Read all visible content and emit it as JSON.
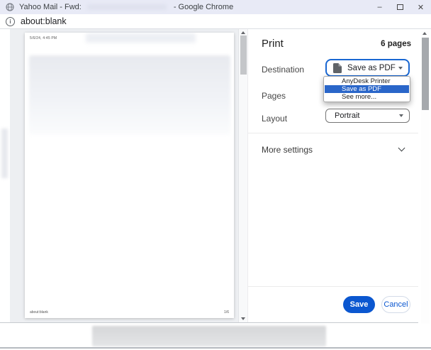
{
  "window": {
    "title_prefix": "Yahoo Mail - Fwd:",
    "title_suffix": "- Google Chrome",
    "controls": {
      "minimize_glyph": "–",
      "close_glyph": "✕"
    }
  },
  "urlbar": {
    "info_glyph": "i",
    "url": "about:blank"
  },
  "preview": {
    "header_datetime": "5/6/24, 4:45 PM",
    "footer_left": "about:blank",
    "footer_right": "1/6"
  },
  "print_panel": {
    "title": "Print",
    "pages_count": "6 pages",
    "destination_label": "Destination",
    "destination_value": "Save as PDF",
    "pages_label": "Pages",
    "layout_label": "Layout",
    "layout_value": "Portrait",
    "more_settings_label": "More settings",
    "dropdown": {
      "items": [
        {
          "label": "AnyDesk Printer",
          "selected": false
        },
        {
          "label": "Save as PDF",
          "selected": true
        },
        {
          "label": "See more...",
          "selected": false
        }
      ]
    },
    "buttons": {
      "save": "Save",
      "cancel": "Cancel"
    }
  },
  "icons": {
    "favicon": "globe-icon",
    "urlbar_info": "info-icon",
    "destination_doc": "pdf-document-icon",
    "select_caret": "caret-down-icon",
    "more_settings": "chevron-down-icon",
    "scrollbar": "scroll-arrow-icons"
  },
  "colors": {
    "titlebar_bg": "#e8eaf6",
    "accent_blue": "#0b57d0",
    "focus_blue": "#1967d2",
    "highlight_blue": "#2a66c9",
    "preview_bg": "#edeff2"
  }
}
